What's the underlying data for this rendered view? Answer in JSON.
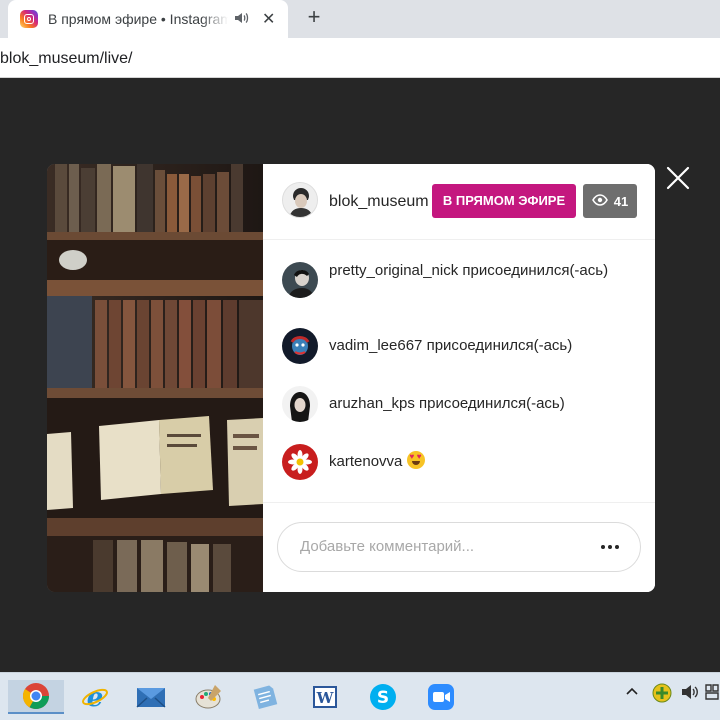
{
  "browser": {
    "tab_title": "В прямом эфире • Instagram",
    "tab_audio_icon": "speaker-icon",
    "tab_close": "✕",
    "new_tab": "+",
    "url": "blok_museum/live/"
  },
  "live": {
    "host_username": "blok_museum",
    "live_label": "В ПРЯМОМ ЭФИРЕ",
    "viewer_count": "41",
    "comments": [
      {
        "username": "pretty_original_nick",
        "text": "pretty_original_nick присоединился(-ась)"
      },
      {
        "username": "vadim_lee667",
        "text": "vadim_lee667 присоединился(-ась)"
      },
      {
        "username": "aruzhan_kps",
        "text": "aruzhan_kps присоединился(-ась)"
      },
      {
        "username": "kartenovva",
        "text": "kartenovva",
        "emoji": "heart-eyes"
      }
    ],
    "comment_placeholder": "Добавьте комментарий..."
  },
  "colors": {
    "live_badge": "#c4177f",
    "viewer_badge": "#6e6e6e",
    "backdrop": "#262626"
  },
  "taskbar": {
    "apps": [
      "chrome-icon",
      "internet-explorer-icon",
      "mail-icon",
      "paint-icon",
      "notepad-icon",
      "word-icon",
      "skype-icon",
      "zoom-icon"
    ],
    "tray": [
      "chevron-up-icon",
      "network-icon",
      "volume-icon",
      "input-icon"
    ]
  }
}
